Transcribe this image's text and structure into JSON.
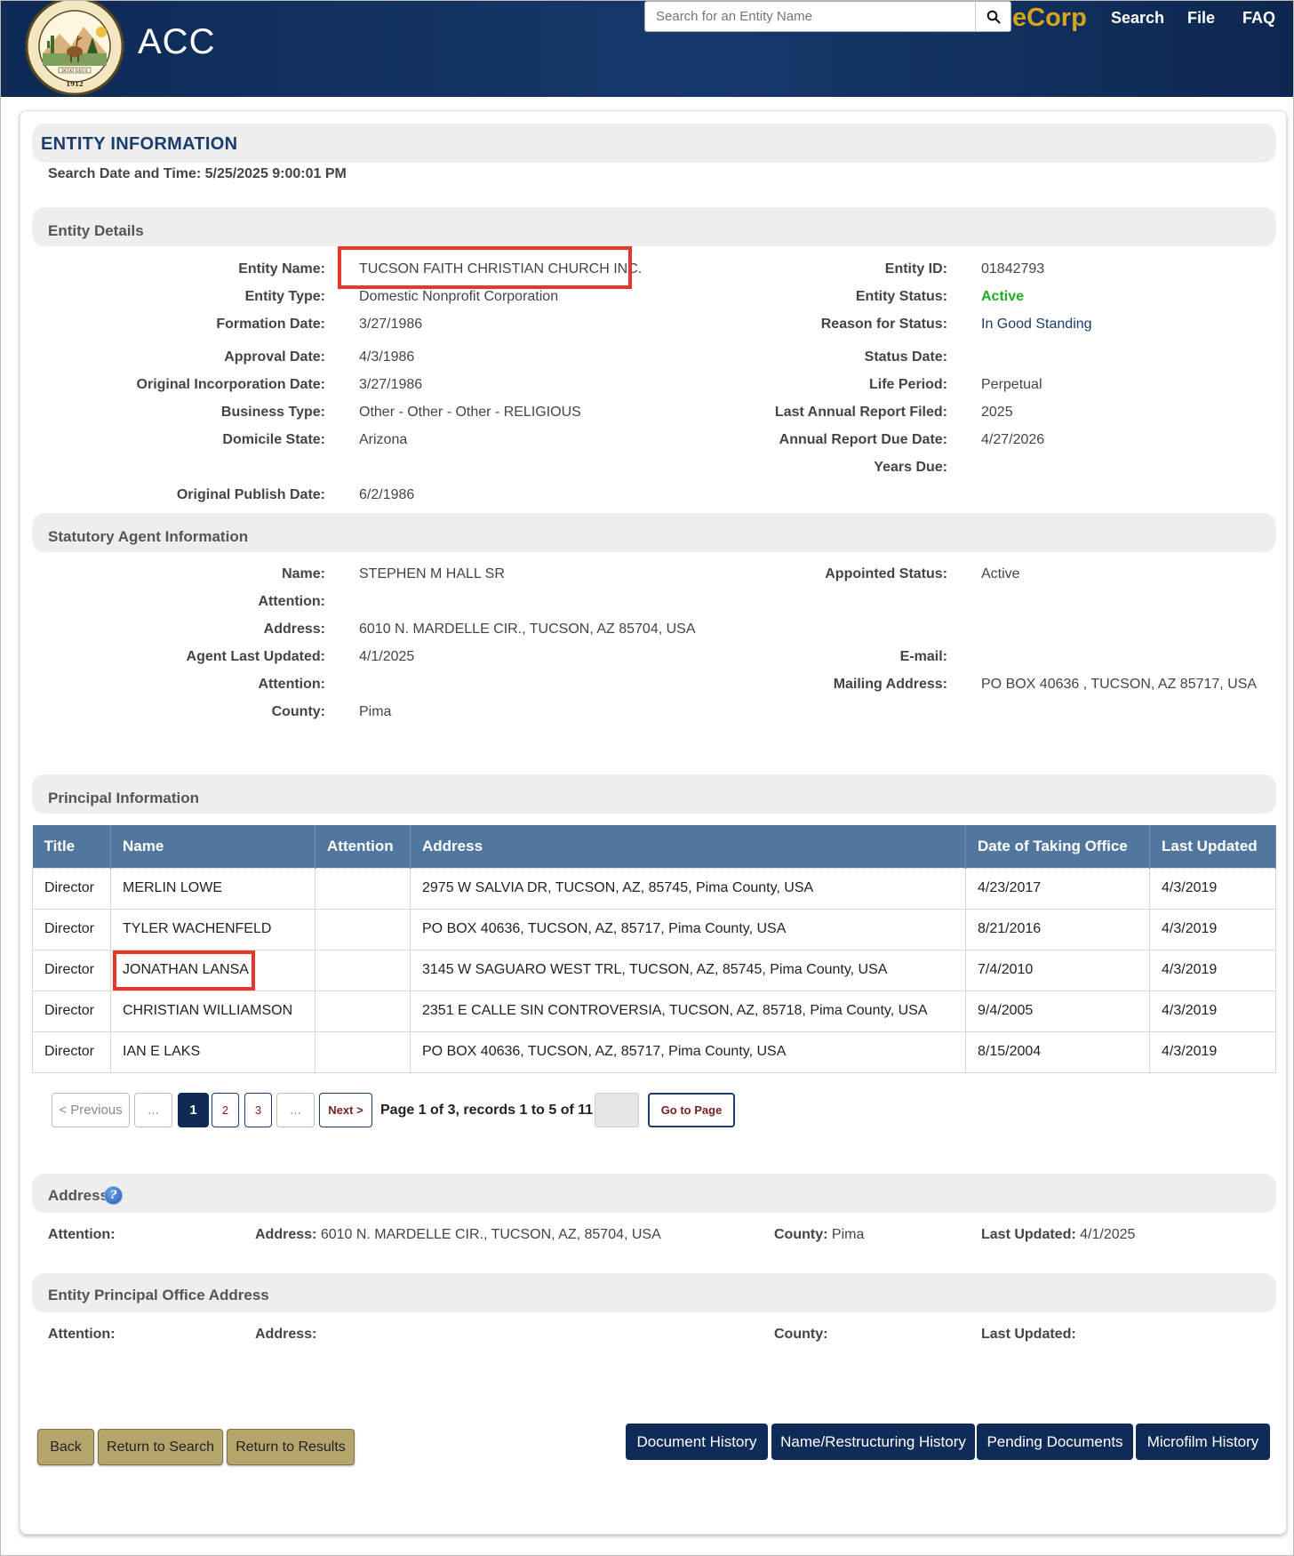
{
  "header": {
    "brand": "ACC",
    "search_placeholder": "Search for an Entity Name",
    "ecorp_label": "eCorp",
    "nav": [
      "Search",
      "File",
      "FAQ"
    ],
    "seal_text": "SEAL OF THE ARIZONA CORPORATION COMMISSION",
    "seal_motto": "DITAT DEUS",
    "seal_year": "1912"
  },
  "entity_info": {
    "title": "ENTITY INFORMATION",
    "search_date": "Search Date and Time: 5/25/2025 9:00:01 PM"
  },
  "entity_details": {
    "section_title": "Entity Details",
    "left": [
      {
        "label": "Entity Name:",
        "value": "TUCSON FAITH CHRISTIAN CHURCH INC."
      },
      {
        "label": "Entity Type:",
        "value": "Domestic Nonprofit Corporation"
      },
      {
        "label": "Formation Date:",
        "value": "3/27/1986"
      },
      {
        "label": "Approval Date:",
        "value": "4/3/1986"
      },
      {
        "label": "Original Incorporation Date:",
        "value": "3/27/1986"
      },
      {
        "label": "Business Type:",
        "value": "Other - Other - Other - RELIGIOUS"
      },
      {
        "label": "Domicile State:",
        "value": "Arizona"
      },
      {
        "label": "Original Publish Date:",
        "value": "6/2/1986"
      }
    ],
    "right": [
      {
        "label": "Entity ID:",
        "value": "01842793"
      },
      {
        "label": "Entity Status:",
        "value": "Active"
      },
      {
        "label": "Reason for Status:",
        "value": "In Good Standing"
      },
      {
        "label": "Status Date:",
        "value": ""
      },
      {
        "label": "Life Period:",
        "value": "Perpetual"
      },
      {
        "label": "Last Annual Report Filed:",
        "value": "2025"
      },
      {
        "label": "Annual Report Due Date:",
        "value": "4/27/2026"
      },
      {
        "label": "Years Due:",
        "value": ""
      }
    ]
  },
  "agent": {
    "section_title": "Statutory Agent Information",
    "left": [
      {
        "label": "Name:",
        "value": "STEPHEN M HALL SR"
      },
      {
        "label": "Attention:",
        "value": ""
      },
      {
        "label": "Address:",
        "value": "6010 N. MARDELLE CIR., TUCSON, AZ 85704, USA"
      },
      {
        "label": "Agent Last Updated:",
        "value": "4/1/2025"
      },
      {
        "label": "Attention:",
        "value": ""
      },
      {
        "label": "County:",
        "value": "Pima"
      }
    ],
    "right": [
      {
        "label": "Appointed Status:",
        "value": "Active"
      },
      {
        "label": "E-mail:",
        "value": ""
      },
      {
        "label": "Mailing Address:",
        "value": "PO BOX 40636 , TUCSON, AZ 85717, USA"
      }
    ]
  },
  "principal": {
    "section_title": "Principal Information",
    "columns": [
      "Title",
      "Name",
      "Attention",
      "Address",
      "Date of Taking Office",
      "Last Updated"
    ],
    "rows": [
      [
        "Director",
        "MERLIN LOWE",
        "",
        "2975 W SALVIA DR, TUCSON, AZ, 85745, Pima County, USA",
        "4/23/2017",
        "4/3/2019"
      ],
      [
        "Director",
        "TYLER WACHENFELD",
        "",
        "PO BOX 40636, TUCSON, AZ, 85717, Pima County, USA",
        "8/21/2016",
        "4/3/2019"
      ],
      [
        "Director",
        "JONATHAN LANSA",
        "",
        "3145 W SAGUARO WEST TRL, TUCSON, AZ, 85745, Pima County, USA",
        "7/4/2010",
        "4/3/2019"
      ],
      [
        "Director",
        "CHRISTIAN WILLIAMSON",
        "",
        "2351 E CALLE SIN CONTROVERSIA, TUCSON, AZ, 85718, Pima County, USA",
        "9/4/2005",
        "4/3/2019"
      ],
      [
        "Director",
        "IAN E LAKS",
        "",
        "PO BOX 40636, TUCSON, AZ, 85717, Pima County, USA",
        "8/15/2004",
        "4/3/2019"
      ]
    ],
    "pager": {
      "previous": "< Previous",
      "ellipsis": "...",
      "pages": [
        "1",
        "2",
        "3"
      ],
      "next": "Next >",
      "info": "Page 1 of 3, records 1 to 5 of 11",
      "goto": "Go to Page"
    }
  },
  "address": {
    "section_title": "Address",
    "attention_label": "Attention:",
    "address_label": "Address:",
    "address_value": "6010 N. MARDELLE CIR., TUCSON, AZ, 85704, USA",
    "county_label": "County:",
    "county_value": "Pima",
    "last_updated_label": "Last Updated:",
    "last_updated_value": "4/1/2025"
  },
  "principal_office": {
    "section_title": "Entity Principal Office Address",
    "attention_label": "Attention:",
    "address_label": "Address:",
    "county_label": "County:",
    "last_updated_label": "Last Updated:"
  },
  "buttons": {
    "back": "Back",
    "return_search": "Return to Search",
    "return_results": "Return to Results",
    "document_history": "Document History",
    "name_history": "Name/Restructuring History",
    "pending_documents": "Pending Documents",
    "microfilm_history": "Microfilm History"
  },
  "colors": {
    "header_navy": "#0e2a55",
    "ecorp_gold": "#d4a51c",
    "status_green": "#22aa22",
    "table_header": "#52779f",
    "highlight_red": "#e5372c",
    "button_tan": "#b5a56c",
    "button_navy": "#0f2c59"
  }
}
